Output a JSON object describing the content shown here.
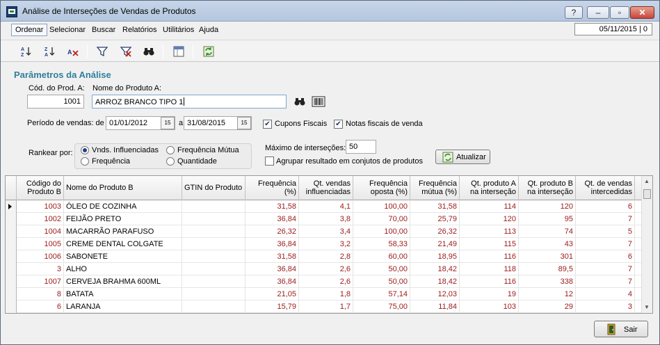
{
  "window": {
    "title": "Análise de Interseções de Vendas de Produtos"
  },
  "titlebar": {
    "help": "?",
    "minimize": "–",
    "maximize": "▫",
    "close": "✕"
  },
  "menu": [
    "Ordenar",
    "Selecionar",
    "Buscar",
    "Relatórios",
    "Utilitários",
    "Ajuda"
  ],
  "status": {
    "date": "05/11/2015 | 0"
  },
  "toolbar": {
    "icons": [
      "sort-asc-icon",
      "sort-desc-icon",
      "clear-sort-icon",
      "filter-icon",
      "clear-filter-icon",
      "binoculars-icon",
      "columns-icon",
      "refresh-icon"
    ]
  },
  "params": {
    "title": "Parâmetros da Análise",
    "cod_label": "Cód. do Prod. A:",
    "cod_value": "1001",
    "nome_label": "Nome do Produto A:",
    "nome_value": "ARROZ BRANCO TIPO 1",
    "periodo_label": "Período de vendas: de",
    "data_de": "01/01/2012",
    "a_label": "a",
    "data_ate": "31/08/2015",
    "cupons_label": "Cupons Fiscais",
    "cupons_checked": true,
    "notas_label": "Notas fiscais de venda",
    "notas_checked": true,
    "rankear_label": "Rankear por:",
    "radio_vnds": "Vnds. Influenciadas",
    "radio_freq": "Frequência",
    "radio_freq_mutua": "Frequência Mútua",
    "radio_qtd": "Quantidade",
    "selected_rank": "Vnds. Influenciadas",
    "max_label": "Máximo de interseções:",
    "max_value": "50",
    "agrupar_label": "Agrupar resultado em conjutos de produtos",
    "agrupar_checked": false,
    "atualizar_label": "Atualizar"
  },
  "grid": {
    "headers": {
      "codigo": "Código do Produto B",
      "nome": "Nome do Produto B",
      "gtin": "GTIN do Produto",
      "freq": "Frequência (%)",
      "qt_vendas_infl": "Qt. vendas influenciadas",
      "freq_oposta": "Frequência oposta (%)",
      "freq_mutua": "Frequência mútua (%)",
      "qt_prod_a": "Qt. produto A na interseção",
      "qt_prod_b": "Qt. produto B na interseção",
      "qt_vendas_inter": "Qt. de vendas intercedidas"
    },
    "rows": [
      {
        "codigo": "1003",
        "nome": "ÓLEO DE COZINHA",
        "gtin": "",
        "freq": "31,58",
        "qt_vendas_infl": "4,1",
        "freq_oposta": "100,00",
        "freq_mutua": "31,58",
        "qt_prod_a": "114",
        "qt_prod_b": "120",
        "qt_vendas_inter": "6"
      },
      {
        "codigo": "1002",
        "nome": "FEIJÃO PRETO",
        "gtin": "",
        "freq": "36,84",
        "qt_vendas_infl": "3,8",
        "freq_oposta": "70,00",
        "freq_mutua": "25,79",
        "qt_prod_a": "120",
        "qt_prod_b": "95",
        "qt_vendas_inter": "7"
      },
      {
        "codigo": "1004",
        "nome": "MACARRÃO PARAFUSO",
        "gtin": "",
        "freq": "26,32",
        "qt_vendas_infl": "3,4",
        "freq_oposta": "100,00",
        "freq_mutua": "26,32",
        "qt_prod_a": "113",
        "qt_prod_b": "74",
        "qt_vendas_inter": "5"
      },
      {
        "codigo": "1005",
        "nome": "CREME DENTAL COLGATE",
        "gtin": "",
        "freq": "36,84",
        "qt_vendas_infl": "3,2",
        "freq_oposta": "58,33",
        "freq_mutua": "21,49",
        "qt_prod_a": "115",
        "qt_prod_b": "43",
        "qt_vendas_inter": "7"
      },
      {
        "codigo": "1006",
        "nome": "SABONETE",
        "gtin": "",
        "freq": "31,58",
        "qt_vendas_infl": "2,8",
        "freq_oposta": "60,00",
        "freq_mutua": "18,95",
        "qt_prod_a": "116",
        "qt_prod_b": "301",
        "qt_vendas_inter": "6"
      },
      {
        "codigo": "3",
        "nome": "ALHO",
        "gtin": "",
        "freq": "36,84",
        "qt_vendas_infl": "2,6",
        "freq_oposta": "50,00",
        "freq_mutua": "18,42",
        "qt_prod_a": "118",
        "qt_prod_b": "89,5",
        "qt_vendas_inter": "7"
      },
      {
        "codigo": "1007",
        "nome": "CERVEJA BRAHMA 600ML",
        "gtin": "",
        "freq": "36,84",
        "qt_vendas_infl": "2,6",
        "freq_oposta": "50,00",
        "freq_mutua": "18,42",
        "qt_prod_a": "116",
        "qt_prod_b": "338",
        "qt_vendas_inter": "7"
      },
      {
        "codigo": "8",
        "nome": "BATATA",
        "gtin": "",
        "freq": "21,05",
        "qt_vendas_infl": "1,8",
        "freq_oposta": "57,14",
        "freq_mutua": "12,03",
        "qt_prod_a": "19",
        "qt_prod_b": "12",
        "qt_vendas_inter": "4"
      },
      {
        "codigo": "6",
        "nome": "LARANJA",
        "gtin": "",
        "freq": "15,79",
        "qt_vendas_infl": "1,7",
        "freq_oposta": "75,00",
        "freq_mutua": "11,84",
        "qt_prod_a": "103",
        "qt_prod_b": "29",
        "qt_vendas_inter": "3"
      }
    ]
  },
  "footer": {
    "sair_label": "Sair"
  },
  "colors": {
    "section_title": "#2f7f9b",
    "value_red": "#9b1a1a"
  }
}
